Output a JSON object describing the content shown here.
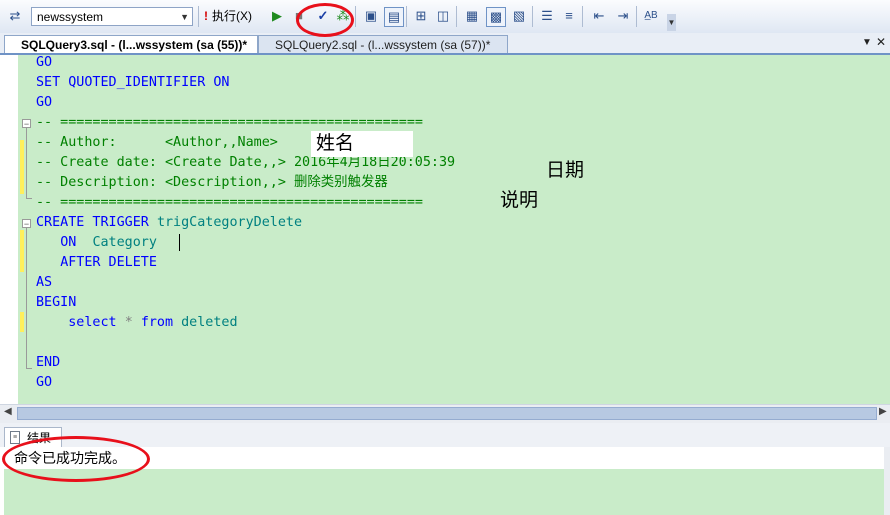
{
  "toolbar": {
    "database": "newssystem",
    "execute_label": "执行(X)"
  },
  "tabs": [
    {
      "label": "SQLQuery3.sql - (l...wssystem (sa (55))*",
      "active": true
    },
    {
      "label": "SQLQuery2.sql - (l...wssystem (sa (57))*",
      "active": false
    }
  ],
  "editor": {
    "go": "GO",
    "set_quoted": "SET QUOTED_IDENTIFIER ON",
    "sep": "-- =============================================",
    "author_prefix": "-- Author:      ",
    "author_placeholder": "<Author,,Name>",
    "date_prefix": "-- Create date: ",
    "date_placeholder": "<Create Date,,>",
    "date_value": "2016年4月18日20:05:39",
    "desc_prefix": "-- Description: ",
    "desc_placeholder": "<Description,,>",
    "desc_value": "删除类别触发器",
    "create_kw": "CREATE TRIGGER",
    "trigger_name": "trigCategoryDelete",
    "on_kw": "ON",
    "table_name": "Category",
    "after_delete": "AFTER DELETE",
    "as_kw": "AS",
    "begin_kw": "BEGIN",
    "select_kw": "select",
    "star": "*",
    "from_kw": "from",
    "deleted": "deleted",
    "end_kw": "END"
  },
  "annotations": {
    "author": "姓名",
    "date": "日期",
    "description": "说明"
  },
  "results": {
    "tab_label": "结果",
    "message": "命令已成功完成。"
  },
  "colors": {
    "editor_bg": "#c9ecc9",
    "keyword": "#0000ff",
    "comment": "#008000",
    "identifier": "#008080",
    "highlight_ring": "#e8101b"
  }
}
